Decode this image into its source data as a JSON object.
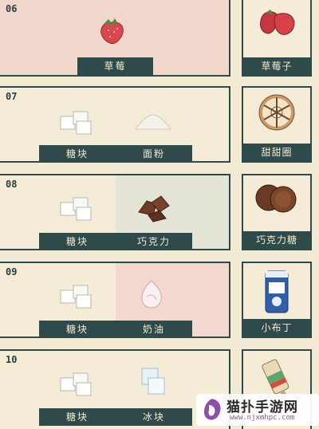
{
  "recipes": [
    {
      "number": "06",
      "ingredients": [
        {
          "name": "草莓",
          "icon": "strawberry-icon"
        }
      ],
      "result": {
        "name": "草莓子",
        "icon": "strawberry-jam-icon"
      }
    },
    {
      "number": "07",
      "ingredients": [
        {
          "name": "糖块",
          "icon": "sugar-cube-icon"
        },
        {
          "name": "面粉",
          "icon": "flour-icon"
        }
      ],
      "result": {
        "name": "甜甜圈",
        "icon": "donut-icon"
      }
    },
    {
      "number": "08",
      "ingredients": [
        {
          "name": "糖块",
          "icon": "sugar-cube-icon"
        },
        {
          "name": "巧克力",
          "icon": "chocolate-icon"
        }
      ],
      "result": {
        "name": "巧克力糖",
        "icon": "chocolate-candy-icon"
      }
    },
    {
      "number": "09",
      "ingredients": [
        {
          "name": "糖块",
          "icon": "sugar-cube-icon"
        },
        {
          "name": "奶油",
          "icon": "cream-icon"
        }
      ],
      "result": {
        "name": "小布丁",
        "icon": "pudding-icon"
      }
    },
    {
      "number": "10",
      "ingredients": [
        {
          "name": "糖块",
          "icon": "sugar-cube-icon"
        },
        {
          "name": "冰块",
          "icon": "ice-cube-icon"
        }
      ],
      "result": {
        "name": "",
        "icon": "popsicle-icon"
      }
    }
  ],
  "watermark": {
    "title": "猫扑手游网",
    "url": "www.njxmhpc.com"
  }
}
